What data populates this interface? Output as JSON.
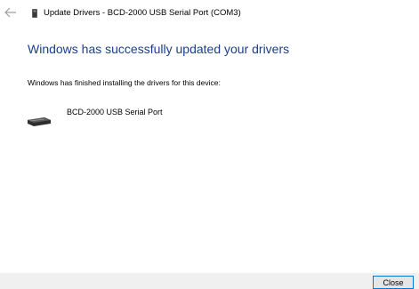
{
  "window": {
    "title": "Update Drivers - BCD-2000 USB Serial Port (COM3)",
    "back_icon": "back-arrow-icon",
    "title_icon": "device-icon"
  },
  "main": {
    "heading": "Windows has successfully updated your drivers",
    "subtext": "Windows has finished installing the drivers for this device:",
    "device": {
      "name": "BCD-2000 USB Serial Port",
      "icon": "usb-serial-device-icon"
    }
  },
  "footer": {
    "close_label": "Close"
  },
  "colors": {
    "heading": "#1a3e8c",
    "footer_bg": "#f0f0f0",
    "button_border": "#0078d7"
  }
}
